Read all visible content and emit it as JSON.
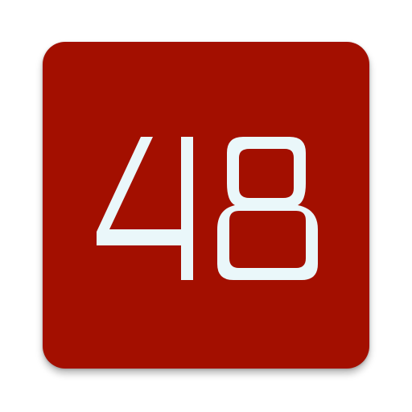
{
  "icon": {
    "label": "48",
    "background_color": "#A30F00",
    "glyph_color": "#EAF7FA"
  }
}
